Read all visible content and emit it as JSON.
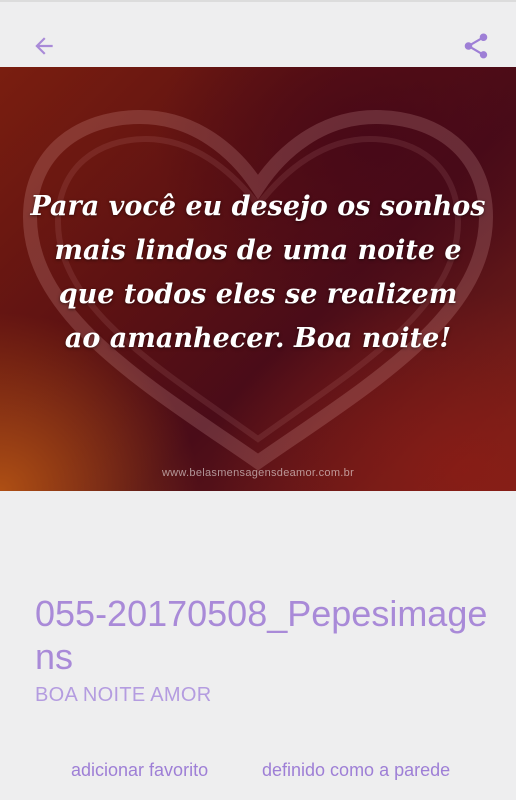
{
  "colors": {
    "accent": "#9e7fd6",
    "background": "#eeeeef"
  },
  "toolbar": {
    "back_icon": "arrow-left-icon",
    "share_icon": "share-icon"
  },
  "image": {
    "quote_lines": [
      "Para você eu desejo os sonhos",
      "mais lindos de uma noite e",
      "que todos eles se realizem",
      "ao amanhecer. Boa noite!"
    ],
    "watermark": "www.belasmensagensdeamor.com.br"
  },
  "details": {
    "title": "055-20170508_Pepesimagens",
    "category": "BOA NOITE AMOR"
  },
  "actions": {
    "favorite_label": "adicionar favorito",
    "wallpaper_label": "definido como a parede"
  }
}
